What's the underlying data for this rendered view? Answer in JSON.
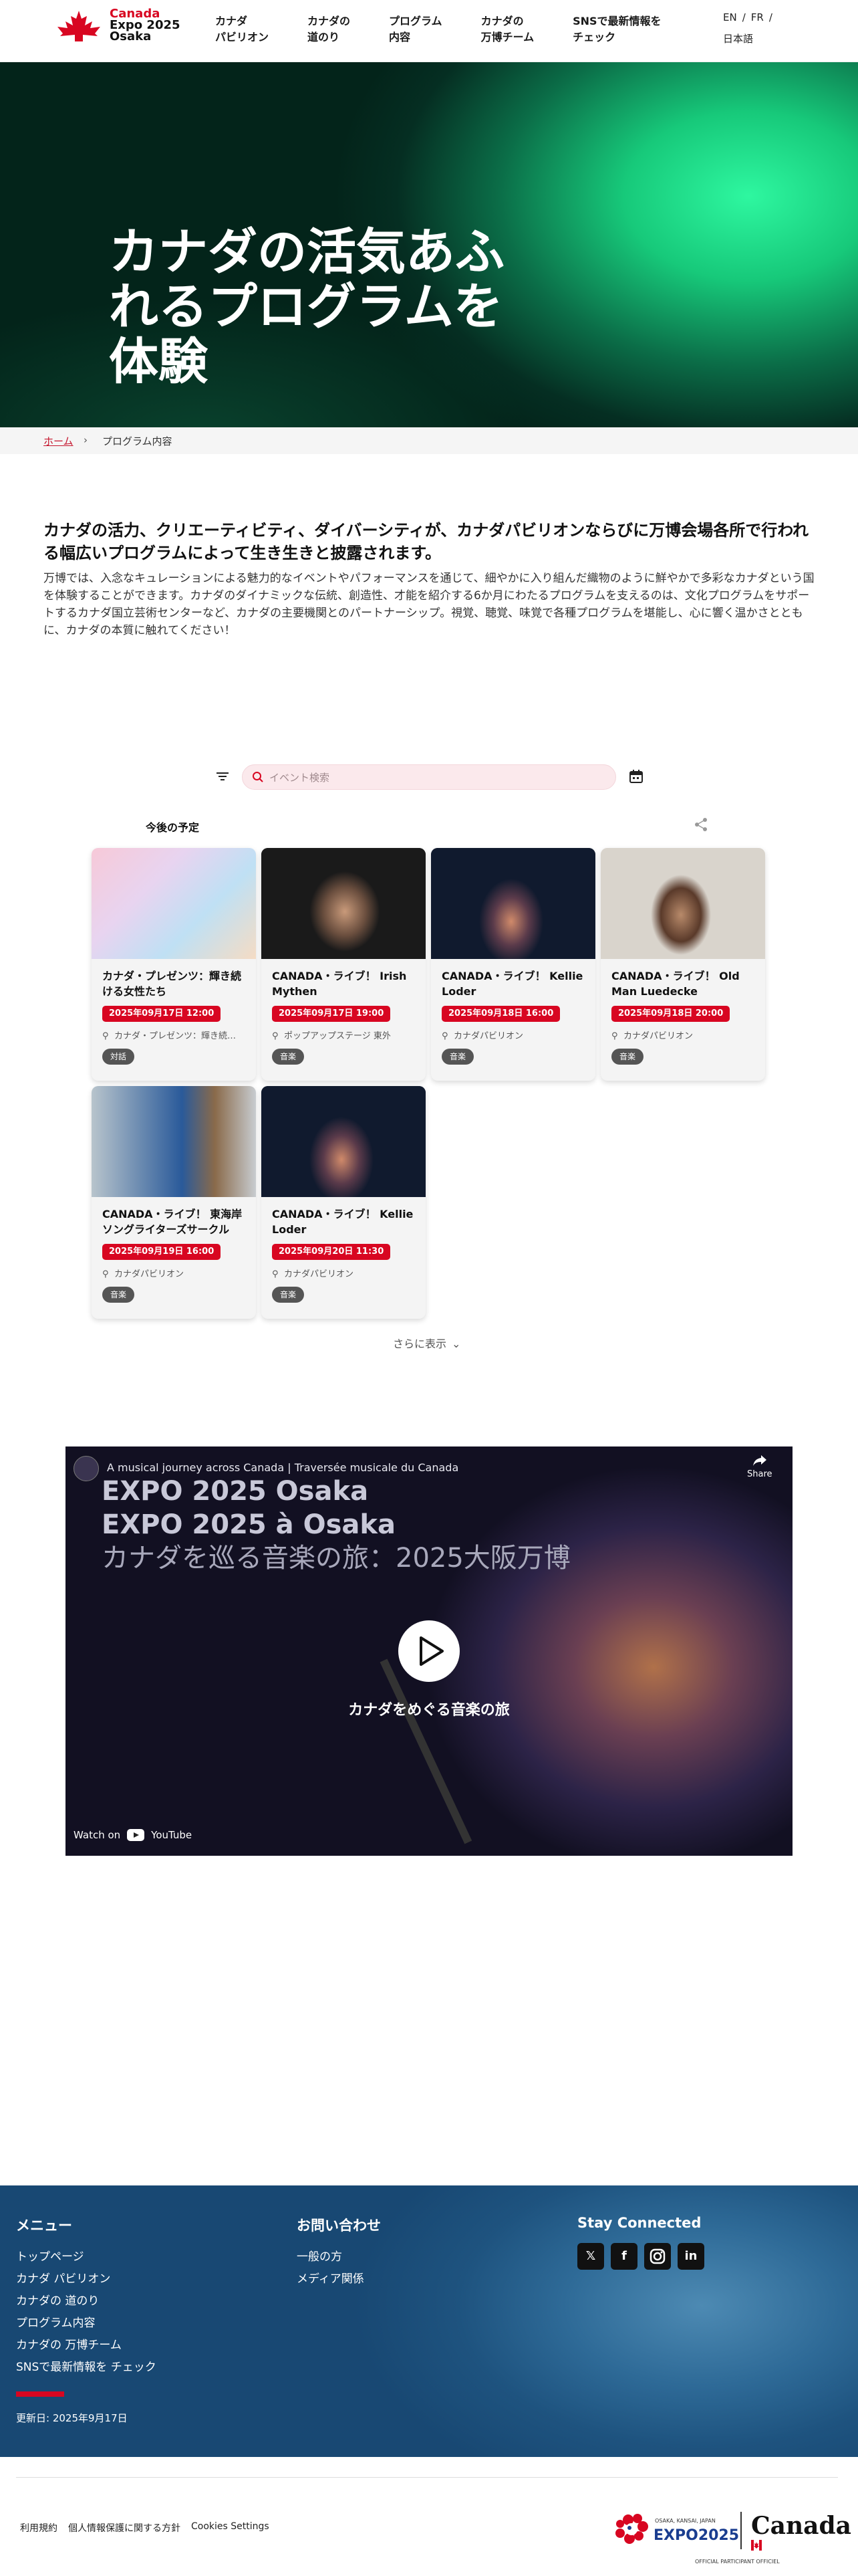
{
  "header": {
    "logo": {
      "line1": "Canada",
      "line2": "Expo 2025",
      "line3": "Osaka"
    },
    "nav": [
      {
        "label": "カナダ\nパビリオン"
      },
      {
        "label": "カナダの\n道のり"
      },
      {
        "label": "プログラム\n内容"
      },
      {
        "label": "カナダの\n万博チーム"
      },
      {
        "label": "SNSで最新情報を\nチェック"
      }
    ],
    "lang": {
      "en": "EN",
      "fr": "FR",
      "ja": "日本語",
      "sep": "/"
    }
  },
  "hero": {
    "title": "カナダの活気あふれるプログラムを体験"
  },
  "breadcrumb": {
    "home": "ホーム",
    "current": "プログラム内容"
  },
  "intro": {
    "heading": "カナダの活力、クリエーティビティ、ダイバーシティが、カナダパビリオンならびに万博会場各所で行われる幅広いプログラムによって生き生きと披露されます。",
    "body": "万博では、入念なキュレーションによる魅力的なイベントやパフォーマンスを通じて、細やかに入り組んだ織物のように鮮やかで多彩なカナダという国を体験することができます。カナダのダイナミックな伝統、創造性、才能を紹介する6か月にわたるプログラムを支えるのは、文化プログラムをサポートするカナダ国立芸術センターなど、カナダの主要機関とのパートナーシップ。視覚、聴覚、味覚で各種プログラムを堪能し、心に響く温かさとともに、カナダの本質に触れてください！"
  },
  "filters": {
    "search_placeholder": "イベント検索"
  },
  "upcoming_label": "今後の予定",
  "events": [
    {
      "title": "カナダ・プレゼンツ：輝き続ける女性たち",
      "date": "2025年09月17日 12:00",
      "location": "カナダ・プレゼンツ：輝き続…",
      "tag": "対話"
    },
    {
      "title": "CANADA・ライブ！ Irish Mythen",
      "date": "2025年09月17日 19:00",
      "location": "ポップアップステージ 東外",
      "tag": "音楽"
    },
    {
      "title": "CANADA・ライブ！ Kellie Loder",
      "date": "2025年09月18日 16:00",
      "location": "カナダパビリオン",
      "tag": "音楽"
    },
    {
      "title": "CANADA・ライブ！ Old Man Luedecke",
      "date": "2025年09月18日 20:00",
      "location": "カナダパビリオン",
      "tag": "音楽"
    },
    {
      "title": "CANADA・ライブ！ 東海岸ソングライターズサークル",
      "date": "2025年09月19日 16:00",
      "location": "カナダパビリオン",
      "tag": "音楽"
    },
    {
      "title": "CANADA・ライブ！ Kellie Loder",
      "date": "2025年09月20日 11:30",
      "location": "カナダパビリオン",
      "tag": "音楽"
    }
  ],
  "more_label": "さらに表示",
  "video": {
    "title": "A musical journey across Canada | Traversée musicale du Canada",
    "share": "Share",
    "overlay_line1": "EXPO 2025 Osaka",
    "overlay_line2": "EXPO 2025 à Osaka",
    "overlay_line3": "カナダを巡る音楽の旅：2025大阪万博",
    "caption": "カナダをめぐる音楽の旅",
    "watch_on": "Watch on",
    "youtube": "YouTube"
  },
  "footer": {
    "menu_heading": "メニュー",
    "menu": [
      "トップページ",
      "カナダ パビリオン",
      "カナダの 道のり",
      "プログラム内容",
      "カナダの 万博チーム",
      "SNSで最新情報を チェック"
    ],
    "contact_heading": "お問い合わせ",
    "contact": [
      "一般の方",
      "メディア関係"
    ],
    "social_heading": "Stay Connected",
    "updated": "更新日: 2025年9月17日",
    "legal": [
      "利用規約",
      "個人情報保護に関する方針",
      "Cookies Settings"
    ],
    "expo_small": "OSAKA, KANSAI, JAPAN",
    "expo_big": "EXPO2025",
    "canada_wordmark": "Canada",
    "official": "OFFICIAL PARTICIPANT OFFICIEL"
  },
  "colors": {
    "brand_red": "#d80621",
    "hero_green": "#2ef7a0",
    "footer_blue": "#2e6a97"
  }
}
